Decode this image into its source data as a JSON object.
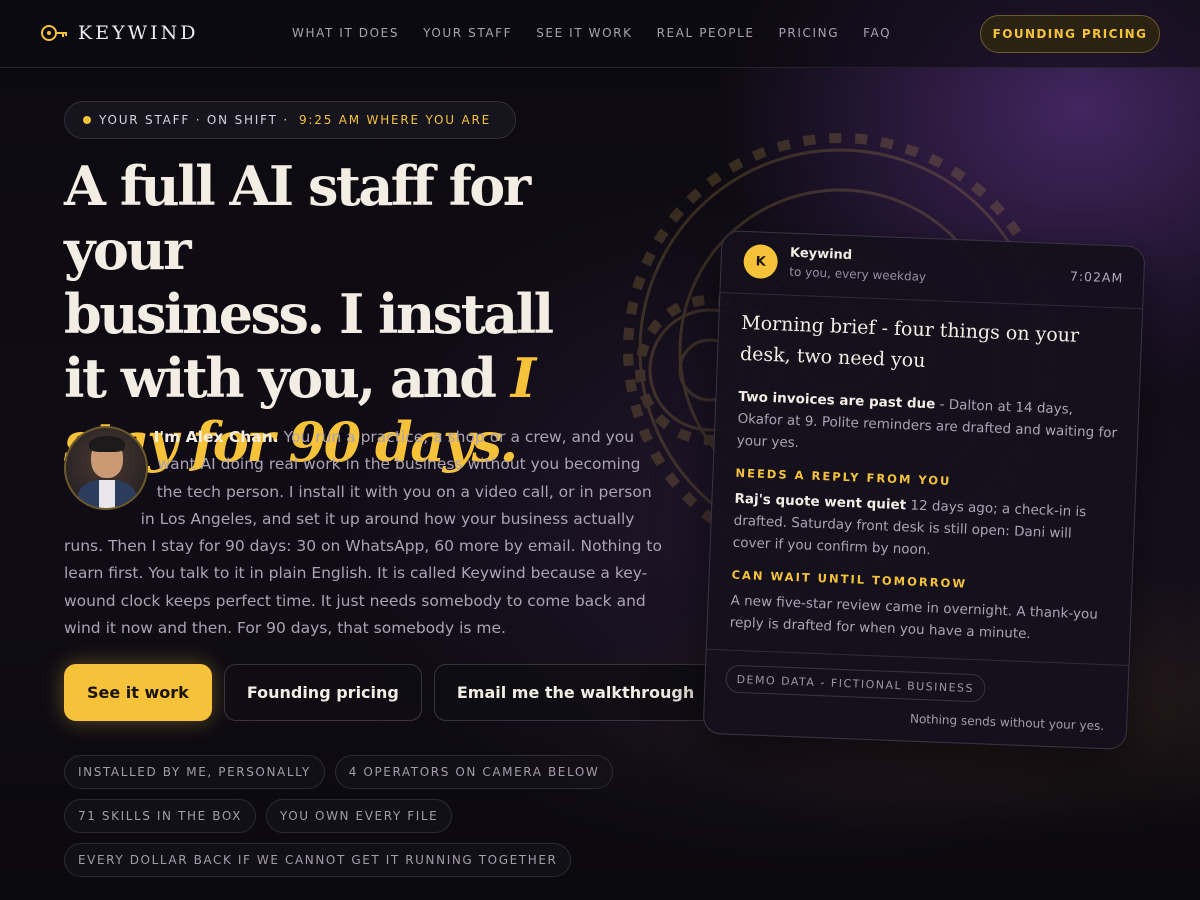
{
  "nav": {
    "brand": "KEYWIND",
    "links": [
      "WHAT IT DOES",
      "YOUR STAFF",
      "SEE IT WORK",
      "REAL PEOPLE",
      "PRICING",
      "FAQ"
    ],
    "cta": "FOUNDING PRICING"
  },
  "status": {
    "main": "YOUR STAFF · ON SHIFT ·",
    "time": "9:25 AM WHERE YOU ARE"
  },
  "hero": {
    "headline_line1": "A full AI staff for your",
    "headline_line2": "business. I install",
    "headline_line3": "it with you, and",
    "headline_accent_inline": "I",
    "headline_accent_line": "stay for 90 days.",
    "intro_name": "I'm Alex Chan.",
    "intro_text": "You run a practice, a shop or a crew, and you want AI doing real work in the business without you becoming the tech person. I install it with you on a video call, or in person in Los Angeles, and set it up around how your business actually runs. Then I stay for 90 days: 30 on WhatsApp, 60 more by email. Nothing to learn first. You talk to it in plain English. It is called Keywind because a key-wound clock keeps perfect time. It just needs somebody to come back and wind it now and then. For 90 days, that somebody is me."
  },
  "buttons": {
    "primary": "See it work",
    "secondary": "Founding pricing",
    "tertiary": "Email me the walkthrough"
  },
  "tags": [
    [
      "INSTALLED BY ME, PERSONALLY",
      "4 OPERATORS ON CAMERA BELOW"
    ],
    [
      "71 SKILLS IN THE BOX",
      "YOU OWN EVERY FILE"
    ],
    [
      "EVERY DOLLAR BACK IF WE CANNOT GET IT RUNNING TOGETHER"
    ]
  ],
  "card": {
    "avatar_letter": "K",
    "sender": "Keywind",
    "sub": "to you, every weekday",
    "time": "7:02AM",
    "title": "Morning brief - four things on your desk, two need you",
    "p1_bold": "Two invoices are past due",
    "p1_rest": " - Dalton at 14 days, Okafor at 9. Polite reminders are drafted and waiting for your yes.",
    "label1": "NEEDS A REPLY FROM YOU",
    "p2_bold": "Raj's quote went quiet",
    "p2_rest": " 12 days ago; a check-in is drafted. Saturday front desk is still open: Dani will cover if you confirm by noon.",
    "label2": "CAN WAIT UNTIL TOMORROW",
    "p3": "A new five-star review came in overnight. A thank-you reply is drafted for when you have a minute.",
    "demo_chip": "DEMO DATA - FICTIONAL BUSINESS",
    "foot_note": "Nothing sends without your yes."
  },
  "colors": {
    "accent": "#f5c23a",
    "background": "#0c0a10",
    "text": "#f3ede4",
    "muted": "#aaa3b3"
  }
}
